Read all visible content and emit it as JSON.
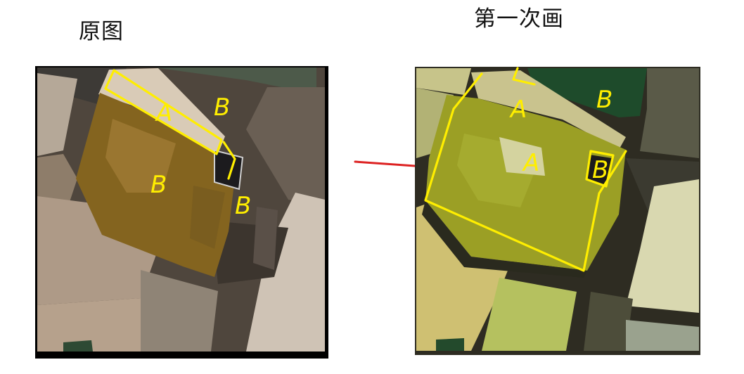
{
  "titles": {
    "original": "原图",
    "first_paint": "第一次画"
  },
  "annotations": {
    "left": [
      {
        "label": "A"
      },
      {
        "label": "B"
      },
      {
        "label": "B"
      },
      {
        "label": "B"
      }
    ],
    "right": [
      {
        "label": "A"
      },
      {
        "label": "A"
      },
      {
        "label": "B"
      },
      {
        "label": "B"
      }
    ]
  },
  "colors": {
    "annotation": "#ffee00",
    "arrow": "#dd2222"
  }
}
